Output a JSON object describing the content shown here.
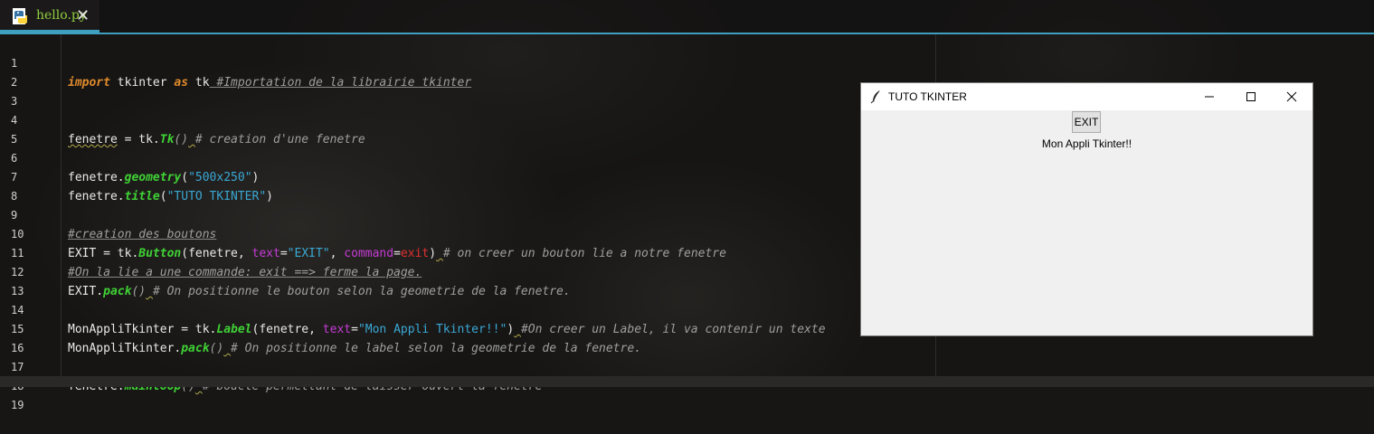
{
  "tab": {
    "filename": "hello.py",
    "close_glyph": "✕"
  },
  "editor": {
    "line_numbers": [
      "1",
      "2",
      "3",
      "4",
      "5",
      "6",
      "7",
      "8",
      "9",
      "10",
      "11",
      "12",
      "13",
      "14",
      "15",
      "16",
      "17",
      "18",
      "19"
    ],
    "lines": {
      "l1": [
        "import",
        " tkinter ",
        "as",
        " tk",
        " ",
        "#Importation de la librairie tkinter"
      ],
      "l4": [
        "fenetre",
        " = tk.",
        "Tk",
        "()",
        " ",
        "# creation d'une fenetre"
      ],
      "l6": [
        "fenetre.",
        "geometry",
        "(",
        "\"500x250\"",
        ")"
      ],
      "l7": [
        "fenetre.",
        "title",
        "(",
        "\"TUTO TKINTER\"",
        ")"
      ],
      "l9": [
        "#creation des boutons"
      ],
      "l10": [
        "EXIT = tk.",
        "Button",
        "(fenetre, ",
        "text",
        "=",
        "\"EXIT\"",
        ", ",
        "command",
        "=",
        "exit",
        ")",
        " ",
        "# on creer un bouton lie a notre fenetre"
      ],
      "l11": [
        "#On la lie a une commande: exit ==> ferme la page."
      ],
      "l12": [
        "EXIT.",
        "pack",
        "()",
        " ",
        "# On positionne le bouton selon la geometrie de la fenetre."
      ],
      "l14": [
        "MonAppliTkinter = tk.",
        "Label",
        "(fenetre, ",
        "text",
        "=",
        "\"Mon Appli Tkinter!!\"",
        ")",
        " ",
        "#On creer un Label, il va contenir un texte"
      ],
      "l15": [
        "MonAppliTkinter.",
        "pack",
        "()",
        " ",
        "# On positionne le label selon la geometrie de la fenetre."
      ],
      "l17": [
        "fenetre.",
        "mainloop",
        "()",
        " ",
        "# boucle permettant de laisser ouvert la fenetre"
      ]
    }
  },
  "tk_window": {
    "title": "TUTO TKINTER",
    "exit_button": "EXIT",
    "label": "Mon Appli Tkinter!!"
  },
  "colors": {
    "keyword": "#e08a2b",
    "function": "#3fd135",
    "string": "#3aa7d4",
    "param": "#c53bd6",
    "comment": "#9e9e9e",
    "accent": "#3f9fc1"
  },
  "icons": [
    "python-file-icon",
    "close-icon",
    "feather-icon",
    "minimize-icon",
    "maximize-icon",
    "window-close-icon"
  ]
}
